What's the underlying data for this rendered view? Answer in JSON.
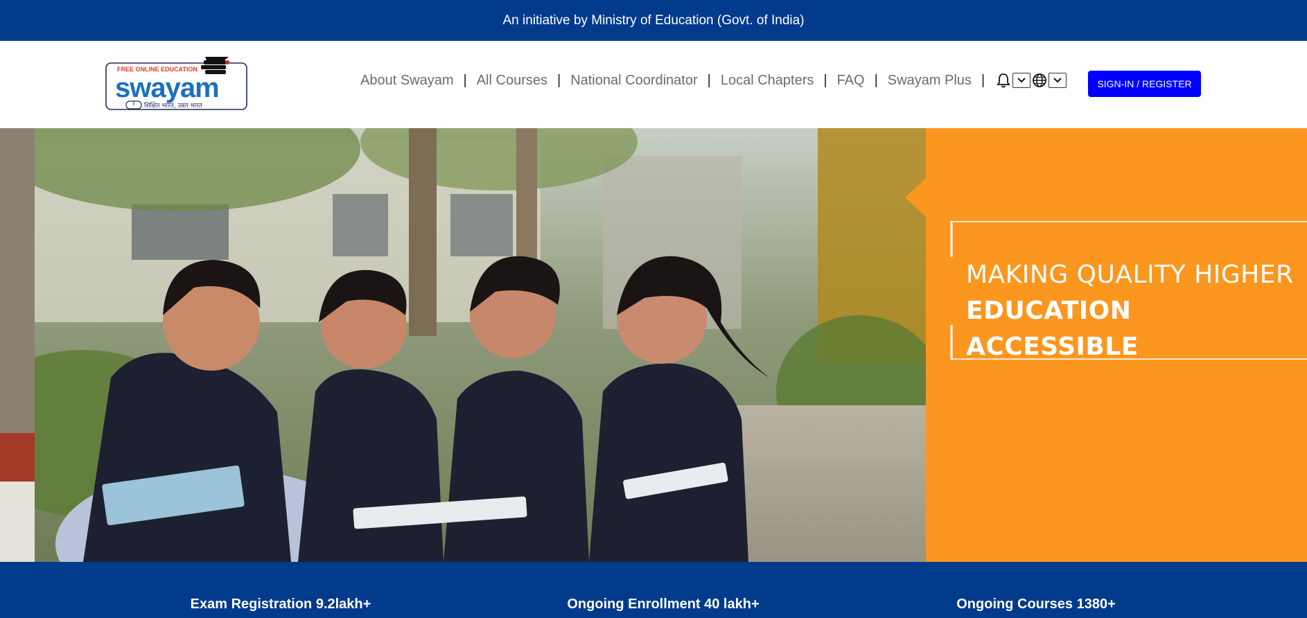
{
  "topbar": {
    "text": "An initiative by Ministry of Education (Govt. of India)"
  },
  "logo": {
    "top_text": "FREE ONLINE EDUCATION",
    "brand": "swayam",
    "tagline": "शिक्षित भारत, उन्नत भारत"
  },
  "nav": {
    "items": [
      {
        "label": "About Swayam"
      },
      {
        "label": "All Courses"
      },
      {
        "label": "National Coordinator"
      },
      {
        "label": "Local Chapters"
      },
      {
        "label": "FAQ"
      },
      {
        "label": "Swayam Plus"
      }
    ],
    "icons": [
      "bell-icon",
      "globe-icon",
      "chevron-down-icon"
    ]
  },
  "signin": {
    "label": "SIGN-IN / REGISTER"
  },
  "hero": {
    "line1": "MAKING QUALITY HIGHER",
    "line2": "EDUCATION ACCESSIBLE"
  },
  "stats": [
    {
      "label": "Exam Registration 9.2lakh+"
    },
    {
      "label": "Ongoing Enrollment 40 lakh+"
    },
    {
      "label": "Ongoing Courses 1380+"
    }
  ],
  "colors": {
    "banner_blue": "#023a8c",
    "signin_blue": "#0000ff",
    "hero_orange": "#fb961f",
    "nav_text": "#6b6b6b"
  }
}
